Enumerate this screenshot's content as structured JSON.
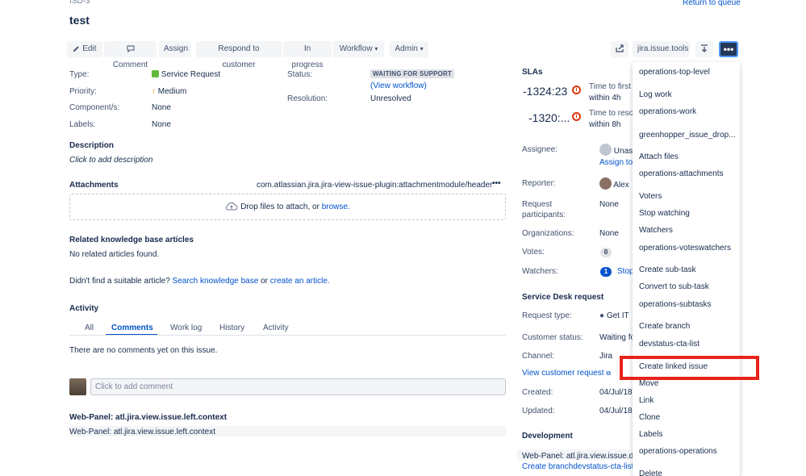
{
  "issue": {
    "key": "ISD-3",
    "title": "test",
    "return_link": "Return to queue"
  },
  "toolbar": {
    "edit": "Edit",
    "comment": "Comment",
    "assign": "Assign",
    "respond": "Respond to customer",
    "in_progress": "In progress",
    "workflow": "Workflow",
    "admin": "Admin",
    "tools": "jira.issue.tools"
  },
  "details": {
    "type_label": "Type:",
    "type_value": "Service Request",
    "priority_label": "Priority:",
    "priority_value": "Medium",
    "components_label": "Component/s:",
    "components_value": "None",
    "labels_label": "Labels:",
    "labels_value": "None",
    "status_label": "Status:",
    "status_value": "WAITING FOR SUPPORT",
    "view_workflow": "(View workflow)",
    "resolution_label": "Resolution:",
    "resolution_value": "Unresolved"
  },
  "description": {
    "heading": "Description",
    "placeholder": "Click to add description"
  },
  "attachments": {
    "heading": "Attachments",
    "module": "com.atlassian.jira.jira-view-issue-plugin:attachmentmodule/header",
    "drop_text": "Drop files to attach, or",
    "browse": "browse."
  },
  "kb": {
    "heading": "Related knowledge base articles",
    "empty": "No related articles found.",
    "prompt": "Didn't find a suitable article?",
    "search_link": "Search knowledge base",
    "or": "or",
    "create_link": "create an article."
  },
  "activity": {
    "heading": "Activity",
    "tabs": [
      "All",
      "Comments",
      "Work log",
      "History",
      "Activity"
    ],
    "empty": "There are no comments yet on this issue.",
    "comment_placeholder": "Click to add comment"
  },
  "webpanel": {
    "heading": "Web-Panel: atl.jira.view.issue.left.context",
    "body": "Web-Panel: atl.jira.view.issue.left.context"
  },
  "slas": {
    "heading": "SLAs",
    "items": [
      {
        "time": "-1324:23",
        "label": "Time to first r",
        "within": "within 4h"
      },
      {
        "time": "-1320:...",
        "label": "Time to resol",
        "within": "within 8h"
      }
    ]
  },
  "people": {
    "assignee_label": "Assignee:",
    "assignee_value": "Unass",
    "assign_link": "Assign to",
    "reporter_label": "Reporter:",
    "reporter_value": "Alex",
    "participants_label_1": "Request",
    "participants_label_2": "participants:",
    "participants_value": "None",
    "organizations_label": "Organizations:",
    "organizations_value": "None",
    "votes_label": "Votes:",
    "votes_value": "0",
    "watchers_label": "Watchers:",
    "watchers_value": "1",
    "watchers_link": "Stop"
  },
  "service_desk": {
    "heading": "Service Desk request",
    "type_label": "Request type:",
    "type_value": "Get IT",
    "status_label": "Customer status:",
    "status_value": "Waiting fo",
    "channel_label": "Channel:",
    "channel_value": "Jira",
    "view_link": "View customer request",
    "created_label": "Created:",
    "created_value": "04/Jul/18",
    "updated_label": "Updated:",
    "updated_value": "04/Jul/18"
  },
  "development": {
    "heading": "Development",
    "panel": "Web-Panel: atl.jira.view.issue.dev",
    "branch_link": "Create branchdevstatus-cta-list"
  },
  "menu": {
    "items": [
      "operations-top-level",
      "Log work",
      "operations-work",
      "greenhopper_issue_drop...",
      "Attach files",
      "operations-attachments",
      "Voters",
      "Stop watching",
      "Watchers",
      "operations-voteswatchers",
      "Create sub-task",
      "Convert to sub-task",
      "operations-subtasks",
      "Create branch",
      "devstatus-cta-list",
      "Create linked issue",
      "Move",
      "Link",
      "Clone",
      "Labels",
      "operations-operations",
      "Delete"
    ]
  },
  "colors": {
    "link": "#0052cc",
    "highlight": "#e8231c",
    "primary": "#0052cc",
    "text": "#172b4d"
  }
}
